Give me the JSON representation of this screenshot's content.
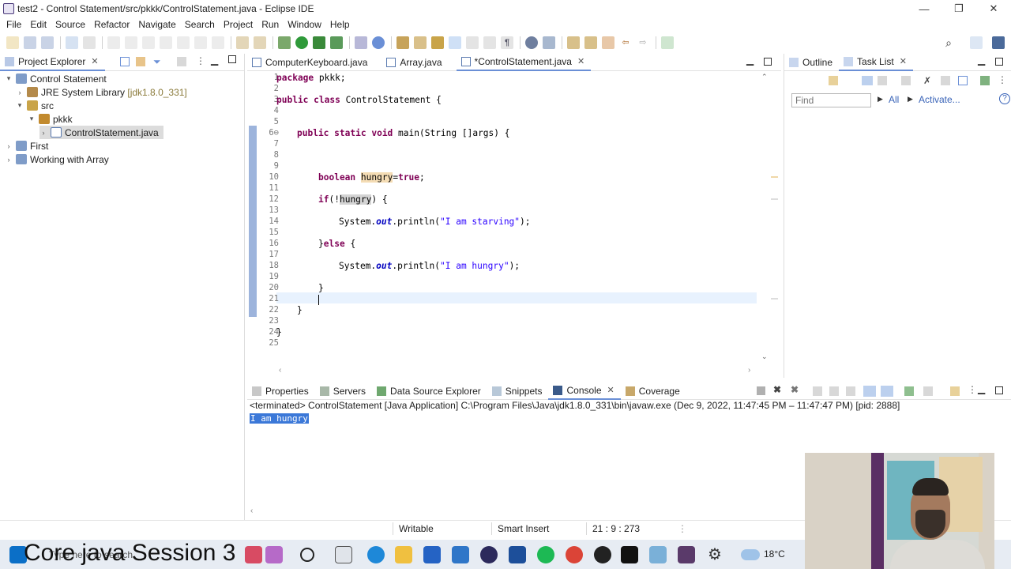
{
  "window": {
    "title": "test2 - Control Statement/src/pkkk/ControlStatement.java - Eclipse IDE",
    "controls": [
      "—",
      "❐",
      "✕"
    ]
  },
  "menu": [
    "File",
    "Edit",
    "Source",
    "Refactor",
    "Navigate",
    "Search",
    "Project",
    "Run",
    "Window",
    "Help"
  ],
  "explorer": {
    "tab_label": "Project Explorer",
    "tree": [
      {
        "label": "Control Statement",
        "depth": 0,
        "expanded": true,
        "icon": "project-icon"
      },
      {
        "label": "JRE System Library",
        "suffix": "[jdk1.8.0_331]",
        "depth": 1,
        "expanded": false,
        "icon": "library-icon"
      },
      {
        "label": "src",
        "depth": 1,
        "expanded": true,
        "icon": "source-folder-icon"
      },
      {
        "label": "pkkk",
        "depth": 2,
        "expanded": true,
        "icon": "package-icon"
      },
      {
        "label": "ControlStatement.java",
        "depth": 3,
        "expanded": false,
        "icon": "java-file-icon",
        "selected": true
      },
      {
        "label": "First",
        "depth": 0,
        "expanded": false,
        "icon": "project-icon"
      },
      {
        "label": "Working with Array",
        "depth": 0,
        "expanded": false,
        "icon": "project-icon"
      }
    ]
  },
  "editor": {
    "tabs": [
      {
        "label": "ComputerKeyboard.java",
        "active": false
      },
      {
        "label": "Array.java",
        "active": false
      },
      {
        "label": "*ControlStatement.java",
        "active": true
      }
    ],
    "line_numbers": [
      "1",
      "2",
      "3",
      "4",
      "5",
      "6⊖",
      "7",
      "8",
      "9",
      "10",
      "11",
      "12",
      "13",
      "14",
      "15",
      "16",
      "17",
      "18",
      "19",
      "20",
      "21",
      "22",
      "23",
      "24",
      "25"
    ],
    "code": {
      "l1": [
        "package",
        " pkkk;"
      ],
      "l3": [
        "public",
        " ",
        "class",
        " ControlStatement {"
      ],
      "l6": [
        "public",
        " ",
        "static",
        " ",
        "void",
        " main(String []args) {"
      ],
      "l10": [
        "boolean",
        " ",
        "hungry",
        "=",
        "true",
        ";"
      ],
      "l12": [
        "if",
        "(!",
        "hungry",
        ") {"
      ],
      "l14": [
        "System.",
        "out",
        ".println(",
        "\"I am starving\"",
        ");"
      ],
      "l16": [
        "}",
        "else",
        " {"
      ],
      "l18": [
        "System.",
        "out",
        ".println(",
        "\"I am hungry\"",
        ");"
      ],
      "l20": [
        "}"
      ],
      "l22": [
        "}"
      ],
      "l24": [
        "}"
      ]
    }
  },
  "right_pane": {
    "tabs": [
      "Outline",
      "Task List"
    ],
    "find_placeholder": "Find",
    "all_label": "All",
    "activate_label": "Activate..."
  },
  "bottom": {
    "tabs": [
      "Properties",
      "Servers",
      "Data Source Explorer",
      "Snippets",
      "Console",
      "Coverage"
    ],
    "console_status": "<terminated> ControlStatement [Java Application] C:\\Program Files\\Java\\jdk1.8.0_331\\bin\\javaw.exe  (Dec 9, 2022, 11:47:45 PM – 11:47:47 PM) [pid: 2888]",
    "console_output": "I am hungry"
  },
  "status_bar": {
    "writable": "Writable",
    "insert_mode": "Smart Insert",
    "position": "21 : 9 : 273"
  },
  "taskbar": {
    "overlay_title": "Core java Session 3",
    "search_hint": "Type here to search",
    "weather": "18°C"
  },
  "colors": {
    "keyword": "#7f0055",
    "string": "#2a00ff",
    "field": "#0000c0",
    "occurrence": "#f4dcb4",
    "selection": "#3b78d8"
  }
}
